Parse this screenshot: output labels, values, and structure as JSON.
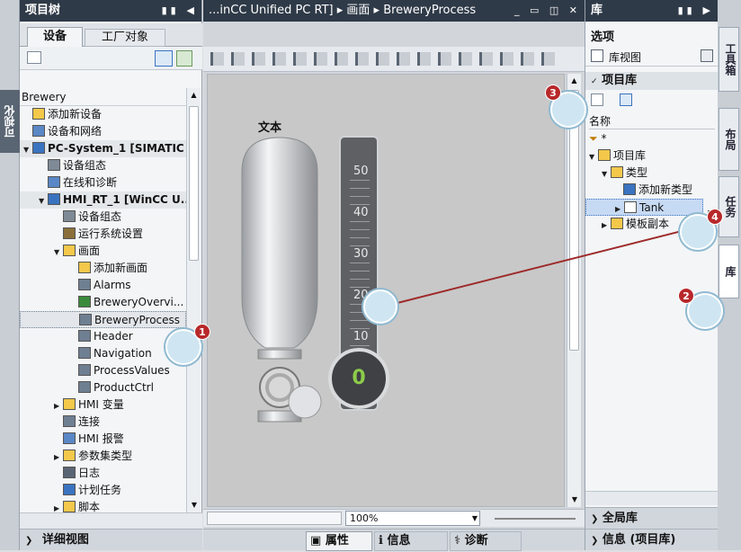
{
  "left_strip": {
    "label": "可视化"
  },
  "project_tree": {
    "title": "项目树",
    "tabs": [
      "设备",
      "工厂对象"
    ],
    "root": "Brewery",
    "items": [
      {
        "label": "添加新设备",
        "indent": 0,
        "exp": ""
      },
      {
        "label": "设备和网络",
        "indent": 0,
        "exp": ""
      },
      {
        "label": "PC-System_1 [SIMATIC ...",
        "indent": 0,
        "exp": "▼"
      },
      {
        "label": "设备组态",
        "indent": 1,
        "exp": ""
      },
      {
        "label": "在线和诊断",
        "indent": 1,
        "exp": ""
      },
      {
        "label": "HMI_RT_1 [WinCC U...",
        "indent": 1,
        "exp": "▼"
      },
      {
        "label": "设备组态",
        "indent": 2,
        "exp": ""
      },
      {
        "label": "运行系统设置",
        "indent": 2,
        "exp": ""
      },
      {
        "label": "画面",
        "indent": 2,
        "exp": "▼"
      },
      {
        "label": "添加新画面",
        "indent": 3,
        "exp": ""
      },
      {
        "label": "Alarms",
        "indent": 3,
        "exp": ""
      },
      {
        "label": "BreweryOvervi...",
        "indent": 3,
        "exp": ""
      },
      {
        "label": "BreweryProcess",
        "indent": 3,
        "exp": ""
      },
      {
        "label": "Header",
        "indent": 3,
        "exp": ""
      },
      {
        "label": "Navigation",
        "indent": 3,
        "exp": ""
      },
      {
        "label": "ProcessValues",
        "indent": 3,
        "exp": ""
      },
      {
        "label": "ProductCtrl",
        "indent": 3,
        "exp": ""
      },
      {
        "label": "HMI 变量",
        "indent": 2,
        "exp": "▶"
      },
      {
        "label": "连接",
        "indent": 2,
        "exp": ""
      },
      {
        "label": "HMI 报警",
        "indent": 2,
        "exp": ""
      },
      {
        "label": "参数集类型",
        "indent": 2,
        "exp": "▶"
      },
      {
        "label": "日志",
        "indent": 2,
        "exp": ""
      },
      {
        "label": "计划任务",
        "indent": 2,
        "exp": ""
      },
      {
        "label": "脚本",
        "indent": 2,
        "exp": "▶"
      }
    ],
    "details": "详细视图"
  },
  "editor": {
    "breadcrumb": "...inCC Unified PC RT] ▸ 画面 ▸ BreweryProcess",
    "canvas_text": "文本",
    "gauge_ticks": [
      "50",
      "40",
      "30",
      "20",
      "10"
    ],
    "gauge_value": "0",
    "zoom": "100%",
    "bottom_tabs": [
      "属性",
      "信息",
      "诊断"
    ]
  },
  "library": {
    "title": "库",
    "options": "选项",
    "lib_view": "库视图",
    "project_lib": "项目库",
    "name_header": "名称",
    "filter": "*",
    "items": [
      {
        "label": "项目库",
        "indent": 0,
        "exp": "▼"
      },
      {
        "label": "类型",
        "indent": 1,
        "exp": "▼"
      },
      {
        "label": "添加新类型",
        "indent": 2,
        "exp": ""
      },
      {
        "label": "Tank",
        "indent": 2,
        "exp": "▶"
      },
      {
        "label": "模板副本",
        "indent": 1,
        "exp": "▶"
      }
    ],
    "global_lib": "全局库",
    "info": "信息 (项目库)"
  },
  "side_tabs": [
    "工具箱",
    "布局",
    "任务",
    "库"
  ],
  "callouts": [
    "1",
    "2",
    "3",
    "4"
  ],
  "colors": {
    "title_bg": "#2f3a48",
    "accent": "#3a74c0",
    "badge": "#b8282a"
  }
}
